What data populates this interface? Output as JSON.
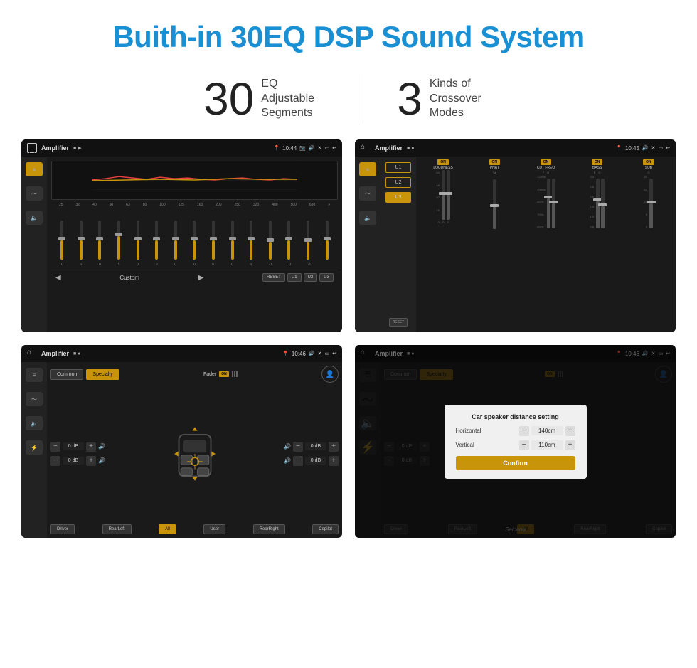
{
  "page": {
    "title": "Buith-in 30EQ DSP Sound System",
    "stat1_number": "30",
    "stat1_label": "EQ Adjustable\nSegments",
    "stat2_number": "3",
    "stat2_label": "Kinds of\nCrossover Modes",
    "watermark": "Seicane"
  },
  "screen1": {
    "title": "Amplifier",
    "time": "10:44",
    "eq_freqs": [
      "25",
      "32",
      "40",
      "50",
      "63",
      "80",
      "100",
      "125",
      "160",
      "200",
      "250",
      "320",
      "400",
      "500",
      "630"
    ],
    "eq_values": [
      "0",
      "0",
      "0",
      "5",
      "0",
      "0",
      "0",
      "0",
      "0",
      "0",
      "0",
      "-1",
      "0",
      "-1",
      ""
    ],
    "mode_label": "Custom",
    "presets": [
      "RESET",
      "U1",
      "U2",
      "U3"
    ]
  },
  "screen2": {
    "title": "Amplifier",
    "time": "10:45",
    "presets": [
      "U1",
      "U2",
      "U3"
    ],
    "channels": [
      {
        "name": "LOUDNESS",
        "on": true
      },
      {
        "name": "PHAT",
        "on": true
      },
      {
        "name": "CUT FREQ",
        "on": true
      },
      {
        "name": "BASS",
        "on": true
      },
      {
        "name": "SUB",
        "on": true
      }
    ],
    "reset_label": "RESET"
  },
  "screen3": {
    "title": "Amplifier",
    "time": "10:46",
    "tabs": [
      "Common",
      "Specialty"
    ],
    "active_tab": "Specialty",
    "fader_label": "Fader",
    "fader_on": true,
    "volumes": [
      "0 dB",
      "0 dB",
      "0 dB",
      "0 dB"
    ],
    "positions": [
      "Driver",
      "RearLeft",
      "All",
      "User",
      "RearRight",
      "Copilot"
    ],
    "active_position": "All"
  },
  "screen4": {
    "title": "Amplifier",
    "time": "10:46",
    "tabs": [
      "Common",
      "Specialty"
    ],
    "dialog": {
      "title": "Car speaker distance setting",
      "horizontal_label": "Horizontal",
      "horizontal_value": "140cm",
      "vertical_label": "Vertical",
      "vertical_value": "110cm",
      "confirm_label": "Confirm"
    },
    "volumes": [
      "0 dB",
      "0 dB"
    ],
    "positions": [
      "Driver",
      "RearLeft",
      "All",
      "RearRight",
      "Copilot"
    ]
  }
}
